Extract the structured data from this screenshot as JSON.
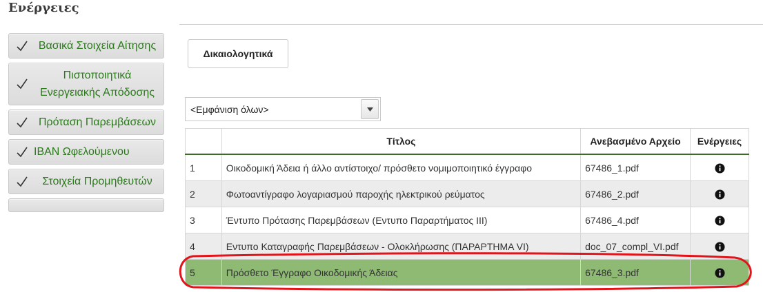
{
  "section_title": "Ενέργειες",
  "sidebar": {
    "items": [
      {
        "label": "Βασικά Στοιχεία Αίτησης",
        "completed": true
      },
      {
        "label": "Πιστοποιητικά Ενεργειακής Απόδοσης",
        "completed": true
      },
      {
        "label": "Πρόταση Παρεμβάσεων",
        "completed": true
      },
      {
        "label": "IBAN Ωφελούμενου",
        "completed": true
      },
      {
        "label": "Στοιχεία Προμηθευτών",
        "completed": true
      }
    ]
  },
  "tab": {
    "label": "Δικαιολογητικά"
  },
  "filter": {
    "selected": "<Εμφάνιση όλων>"
  },
  "table": {
    "headers": [
      "",
      "Τίτλος",
      "Ανεβασμένο Αρχείο",
      "Ενέργειες"
    ],
    "rows": [
      {
        "num": "1",
        "title": "Οικοδομική Άδεια ή άλλο αντίστοιχο/ πρόσθετο νομιμοποιητικό έγγραφο",
        "file": "67486_1.pdf",
        "action_icon": "info-icon"
      },
      {
        "num": "2",
        "title": "Φωτοαντίγραφο λογαριασμού παροχής ηλεκτρικού ρεύματος",
        "file": "67486_2.pdf",
        "action_icon": "info-icon"
      },
      {
        "num": "3",
        "title": "Έντυπο Πρότασης Παρεμβάσεων (Εντυπο Παραρτήματος ΙΙΙ)",
        "file": "67486_4.pdf",
        "action_icon": "info-icon"
      },
      {
        "num": "4",
        "title": "Εντυπο Καταγραφής Παρεμβάσεων - Ολοκλήρωσης (ΠΑΡΑΡΤΗΜΑ VI)",
        "file": "doc_07_compl_VI.pdf",
        "action_icon": "info-icon"
      },
      {
        "num": "5",
        "title": "Πρόσθετο Έγγραφο Οικοδομικής Άδειας",
        "file": "67486_3.pdf",
        "action_icon": "info-icon",
        "highlighted": true
      }
    ]
  },
  "colors": {
    "sidebar_text": "#2a7a1a",
    "highlight_row": "#8fba74",
    "header_rule": "#3e6b25",
    "annotation_circle": "#e0151b"
  }
}
